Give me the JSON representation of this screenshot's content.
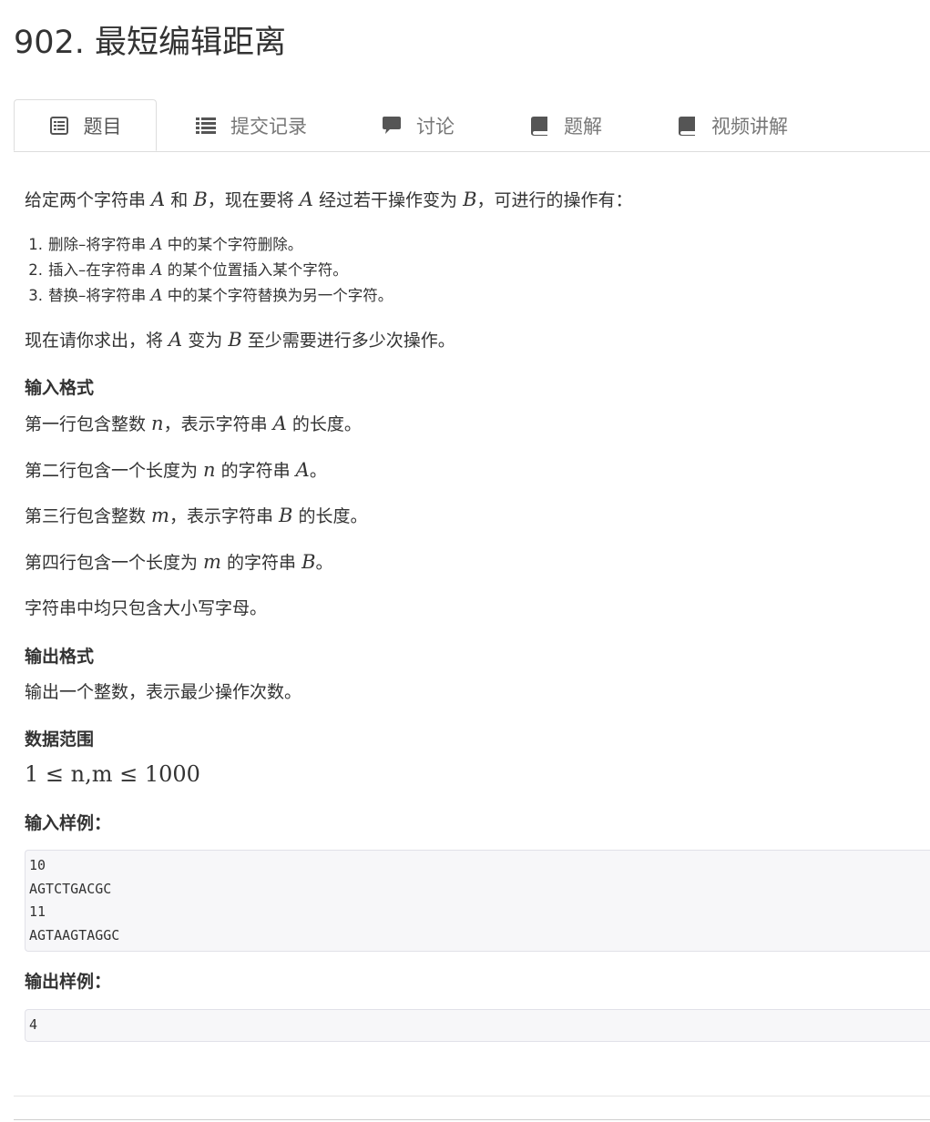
{
  "title": "902. 最短编辑距离",
  "tabs": [
    {
      "label": "题目",
      "icon": "list-alt-icon"
    },
    {
      "label": "提交记录",
      "icon": "list-icon"
    },
    {
      "label": "讨论",
      "icon": "comment-icon"
    },
    {
      "label": "题解",
      "icon": "book-icon"
    },
    {
      "label": "视频讲解",
      "icon": "book-icon"
    }
  ],
  "problem": {
    "intro_a": "给定两个字符串 ",
    "intro_A1": "A",
    "intro_b": " 和 ",
    "intro_B1": "B",
    "intro_c": "，现在要将 ",
    "intro_A2": "A",
    "intro_d": " 经过若干操作变为 ",
    "intro_B2": "B",
    "intro_e": "，可进行的操作有：",
    "ops": [
      {
        "num": "1.",
        "pre": "删除–将字符串 ",
        "var": "A",
        "post": " 中的某个字符删除。"
      },
      {
        "num": "2.",
        "pre": "插入–在字符串 ",
        "var": "A",
        "post": " 的某个位置插入某个字符。"
      },
      {
        "num": "3.",
        "pre": "替换–将字符串 ",
        "var": "A",
        "post": " 中的某个字符替换为另一个字符。"
      }
    ],
    "ask_a": "现在请你求出，将 ",
    "ask_A": "A",
    "ask_b": " 变为 ",
    "ask_B": "B",
    "ask_c": " 至少需要进行多少次操作。",
    "input_heading": "输入格式",
    "input_lines": [
      {
        "pre": "第一行包含整数 ",
        "var": "n",
        "post": "，表示字符串 ",
        "var2": "A",
        "post2": " 的长度。"
      },
      {
        "pre": "第二行包含一个长度为 ",
        "var": "n",
        "post": " 的字符串 ",
        "var2": "A",
        "post2": "。"
      },
      {
        "pre": "第三行包含整数 ",
        "var": "m",
        "post": "，表示字符串 ",
        "var2": "B",
        "post2": " 的长度。"
      },
      {
        "pre": "第四行包含一个长度为 ",
        "var": "m",
        "post": " 的字符串 ",
        "var2": "B",
        "post2": "。"
      }
    ],
    "input_note": "字符串中均只包含大小写字母。",
    "output_heading": "输出格式",
    "output_text": "输出一个整数，表示最少操作次数。",
    "range_heading": "数据范围",
    "range_text": "1 ≤ n,m ≤ 1000",
    "sample_in_heading": "输入样例：",
    "sample_in": [
      "10",
      "AGTCTGACGC",
      "11",
      "AGTAAGTAGGC"
    ],
    "sample_out_heading": "输出样例：",
    "sample_out": [
      "4"
    ]
  }
}
